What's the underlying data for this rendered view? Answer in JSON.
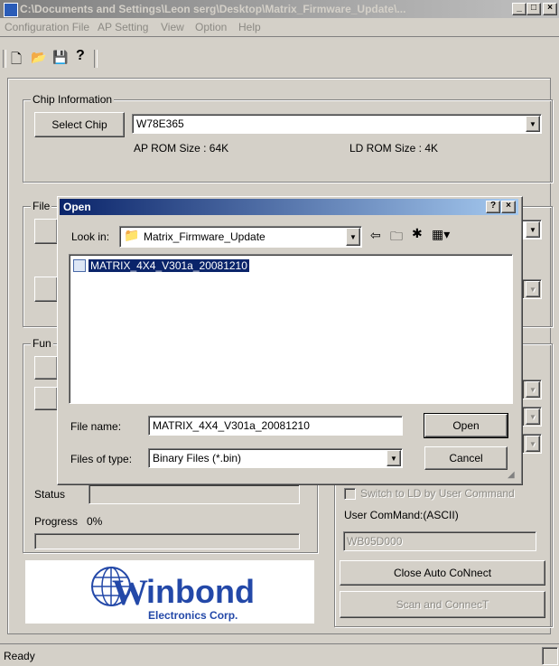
{
  "main_window": {
    "title": "C:\\Documents and Settings\\Leon serg\\Desktop\\Matrix_Firmware_Update\\...",
    "menu": [
      "Configuration File",
      "AP Setting",
      "View",
      "Option",
      "Help"
    ],
    "chip_info": {
      "group_label": "Chip Information",
      "select_chip_label": "Select Chip",
      "chip_value": "W78E365",
      "ap_rom": "AP ROM Size : 64K",
      "ld_rom": "LD ROM Size : 4K"
    },
    "file_group_label": "File",
    "function_group_label": "Fun",
    "status_label": "Status",
    "progress_label": "Progress",
    "progress_value": "0%",
    "switch_ld_label": "Switch to LD by User Command",
    "user_command_label": "User ComMand:(ASCII)",
    "user_command_value": "WB05D000",
    "close_connect_label": "Close Auto CoNnect",
    "scan_connect_label": "Scan and ConnecT",
    "logo_text": "inbond",
    "logo_sub": "Electronics Corp.",
    "status_bar": "Ready"
  },
  "open_dialog": {
    "title": "Open",
    "look_in_label": "Look in:",
    "look_in_value": "Matrix_Firmware_Update",
    "files": [
      "MATRIX_4X4_V301a_20081210"
    ],
    "file_name_label": "File name:",
    "file_name_value": "MATRIX_4X4_V301a_20081210",
    "files_of_type_label": "Files of type:",
    "files_of_type_value": "Binary Files (*.bin)",
    "open_label": "Open",
    "cancel_label": "Cancel"
  }
}
